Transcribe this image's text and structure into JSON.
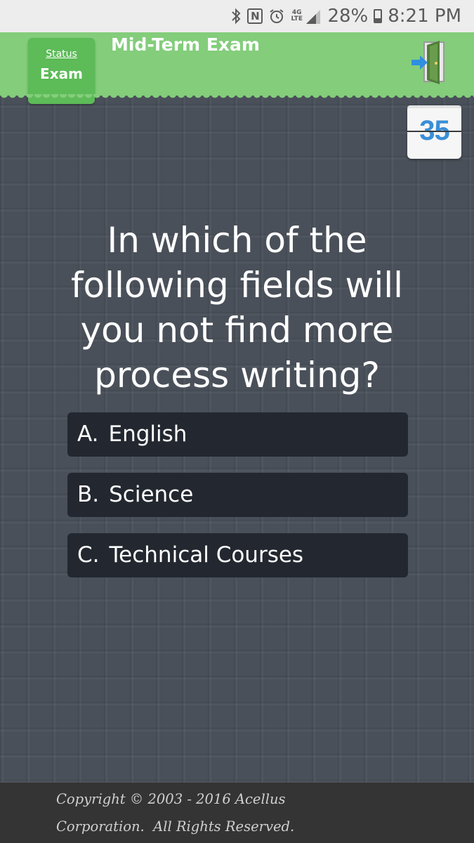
{
  "status_bar": {
    "battery": "28%",
    "time": "8:21 PM",
    "lte": "4G\nLTE",
    "icons": [
      "bluetooth-icon",
      "nfc-icon",
      "alarm-icon",
      "lte-icon",
      "signal-icon",
      "battery-icon"
    ]
  },
  "header": {
    "status_link": "Status",
    "status_value": "Exam",
    "title": "Mid-Term Exam",
    "exit_icon": "exit-door-icon",
    "accent_color": "#83cd7b"
  },
  "timer": {
    "value": "35"
  },
  "question": {
    "text": "In which of the following fields will you not find more process writing?"
  },
  "answers": [
    {
      "letter": "A.",
      "text": "English"
    },
    {
      "letter": "B.",
      "text": "Science"
    },
    {
      "letter": "C.",
      "text": "Technical Courses"
    }
  ],
  "footer": {
    "line1": "Copyright © 2003 - 2016 Acellus",
    "line2": "Corporation.  All Rights Reserved."
  }
}
